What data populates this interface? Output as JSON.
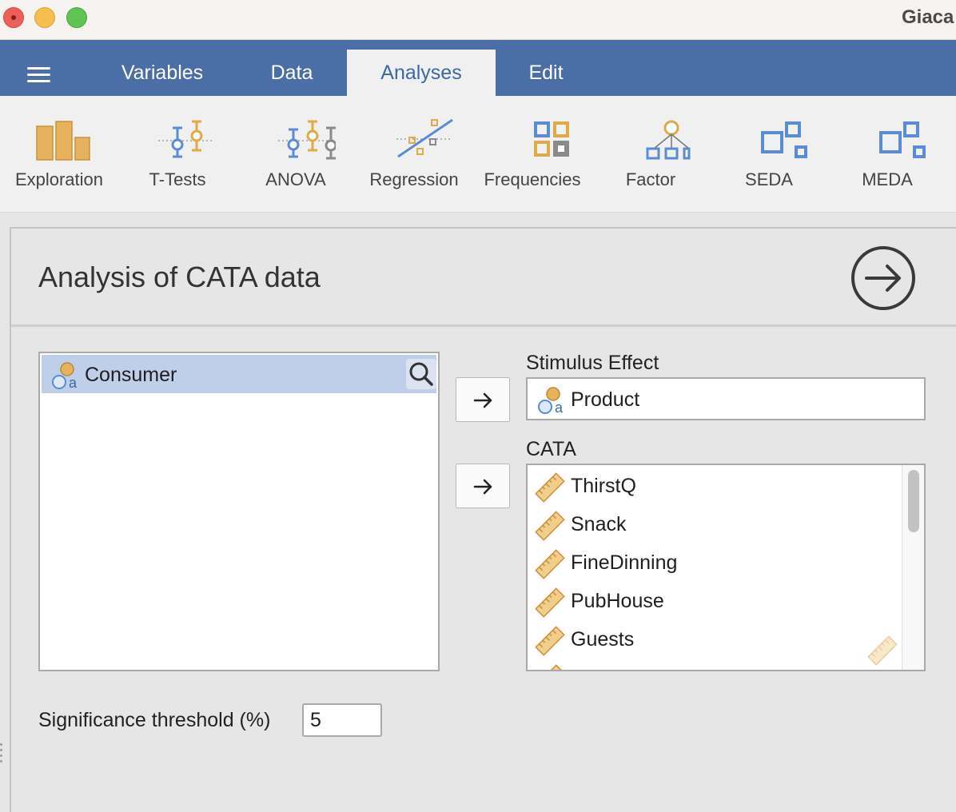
{
  "window": {
    "title": "Giaca"
  },
  "menubar": {
    "tabs": [
      {
        "label": "Variables"
      },
      {
        "label": "Data"
      },
      {
        "label": "Analyses",
        "active": true
      },
      {
        "label": "Edit"
      }
    ]
  },
  "ribbon": {
    "items": [
      {
        "label": "Exploration",
        "icon": "exploration-icon"
      },
      {
        "label": "T-Tests",
        "icon": "t-tests-icon"
      },
      {
        "label": "ANOVA",
        "icon": "anova-icon"
      },
      {
        "label": "Regression",
        "icon": "regression-icon"
      },
      {
        "label": "Frequencies",
        "icon": "frequencies-icon"
      },
      {
        "label": "Factor",
        "icon": "factor-icon"
      },
      {
        "label": "SEDA",
        "icon": "seda-icon"
      },
      {
        "label": "MEDA",
        "icon": "meda-icon"
      }
    ]
  },
  "panel": {
    "title": "Analysis of CATA data",
    "source": {
      "items": [
        {
          "label": "Consumer",
          "type": "nominal"
        }
      ]
    },
    "stimulus": {
      "label": "Stimulus Effect",
      "value": "Product"
    },
    "cata": {
      "label": "CATA",
      "items": [
        "ThirstQ",
        "Snack",
        "FineDinning",
        "PubHouse",
        "Guests"
      ]
    },
    "significance": {
      "label": "Significance threshold (%)",
      "value": "5"
    }
  },
  "colors": {
    "menubar": "#4a6ea5",
    "active_tab_text": "#3c68a8",
    "selection": "#bfcfe9",
    "icon_blue": "#5b8bd6",
    "icon_gold": "#e0a94a"
  }
}
